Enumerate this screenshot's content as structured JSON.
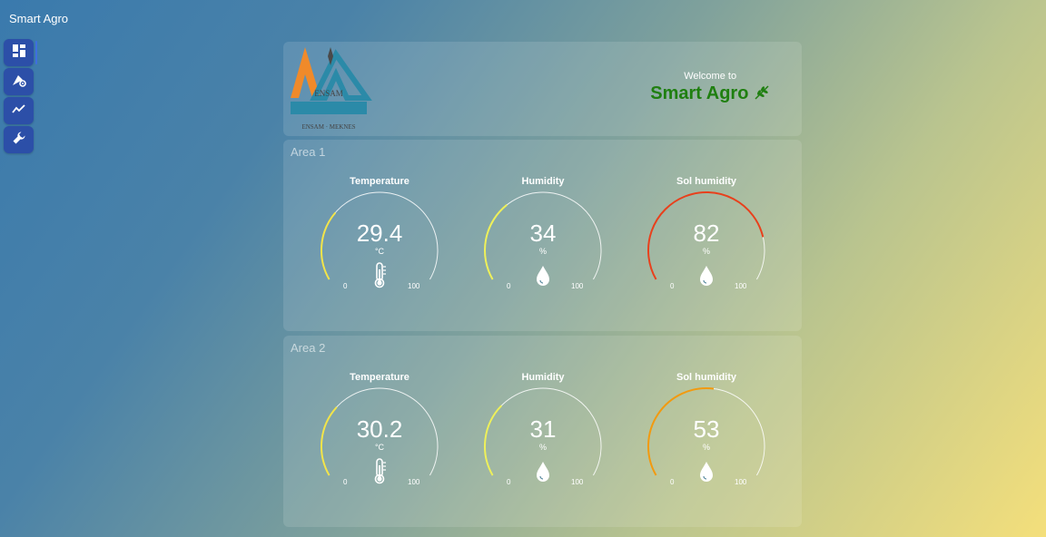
{
  "app": {
    "title": "Smart Agro"
  },
  "sidebar": {
    "items": [
      {
        "icon": "dashboard-icon",
        "active": true
      },
      {
        "icon": "field-settings-icon",
        "active": false
      },
      {
        "icon": "trend-chart-icon",
        "active": false
      },
      {
        "icon": "wrench-icon",
        "active": false
      }
    ]
  },
  "header": {
    "logo_text": "ENSAM",
    "logo_subtext": "ENSAM · MEKNES",
    "welcome_small": "Welcome to",
    "welcome_big": "Smart Agro",
    "leaf_icon": "leaf-icon"
  },
  "colors": {
    "temp_arc": "#f2e44a",
    "humidity_arc": "#eef05a",
    "sol1_arc": "#e8401c",
    "sol2_arc": "#f29a10",
    "track": "rgba(255,255,255,0.85)"
  },
  "areas": [
    {
      "title": "Area 1",
      "gauges": [
        {
          "label": "Temperature",
          "value": "29.4",
          "unit": "°C",
          "min": "0",
          "max": "100",
          "fraction": 0.294,
          "icon": "thermometer-icon"
        },
        {
          "label": "Humidity",
          "value": "34",
          "unit": "%",
          "min": "0",
          "max": "100",
          "fraction": 0.34,
          "icon": "water-drop-icon"
        },
        {
          "label": "Sol humidity",
          "value": "82",
          "unit": "%",
          "min": "0",
          "max": "100",
          "fraction": 0.82,
          "icon": "water-drop-icon"
        }
      ]
    },
    {
      "title": "Area 2",
      "gauges": [
        {
          "label": "Temperature",
          "value": "30.2",
          "unit": "°C",
          "min": "0",
          "max": "100",
          "fraction": 0.302,
          "icon": "thermometer-icon"
        },
        {
          "label": "Humidity",
          "value": "31",
          "unit": "%",
          "min": "0",
          "max": "100",
          "fraction": 0.31,
          "icon": "water-drop-icon"
        },
        {
          "label": "Sol humidity",
          "value": "53",
          "unit": "%",
          "min": "0",
          "max": "100",
          "fraction": 0.53,
          "icon": "water-drop-icon"
        }
      ]
    }
  ]
}
